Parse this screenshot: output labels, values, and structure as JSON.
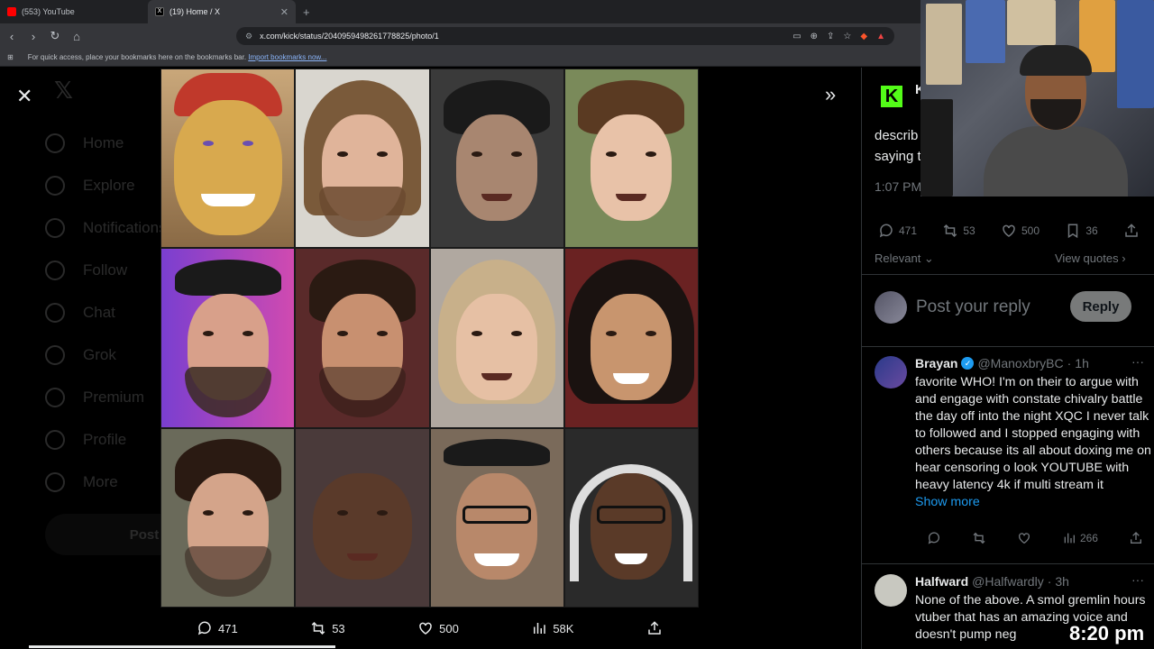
{
  "browser": {
    "tabs": [
      {
        "title": "(553) YouTube",
        "icon": "youtube-icon"
      },
      {
        "title": "(19) Home / X",
        "icon": "x-icon"
      }
    ],
    "url": "x.com/kick/status/2040959498261778825/photo/1",
    "bookmarks_bar_text": "For quick access, place your bookmarks here on the bookmarks bar.",
    "bookmarks_link": "Import bookmarks now..."
  },
  "sidebar_bg": {
    "items": [
      "Home",
      "Explore",
      "Notifications",
      "Follow",
      "Chat",
      "Grok",
      "Premium",
      "Profile",
      "More"
    ],
    "post_label": "Post"
  },
  "media_actions": {
    "replies": "471",
    "reposts": "53",
    "likes": "500",
    "views": "58K"
  },
  "tweet": {
    "author_initial": "K",
    "text_fragment": "describ  saying t",
    "time": "1:07 PM",
    "stats": {
      "replies": "471",
      "reposts": "53",
      "likes": "500",
      "bookmarks": "36"
    },
    "sort_label": "Relevant",
    "view_quotes": "View quotes"
  },
  "reply_box": {
    "placeholder": "Post your reply",
    "button": "Reply"
  },
  "comments": [
    {
      "name": "Brayan",
      "handle": "@ManoxbryBC",
      "age": "1h",
      "verified": true,
      "text": "favorite WHO! I'm on their to argue with and engage with constate chivalry battle the day off into the night XQC I never talk to followed and I stopped engaging with others because its all about doxing me on hear censoring o look YOUTUBE with heavy latency 4k if multi stream it",
      "show_more": "Show more",
      "views": "266"
    },
    {
      "name": "Halfward",
      "handle": "@Halfwardly",
      "age": "3h",
      "verified": false,
      "text": "None of the above. A smol gremlin hours vtuber that has an amazing voice and doesn't pump neg"
    }
  ],
  "overlay_clock": "8:20 pm",
  "colors": {
    "accent_blue": "#1d9bf0",
    "kick_green": "#53fc18",
    "muted": "#71767b"
  }
}
